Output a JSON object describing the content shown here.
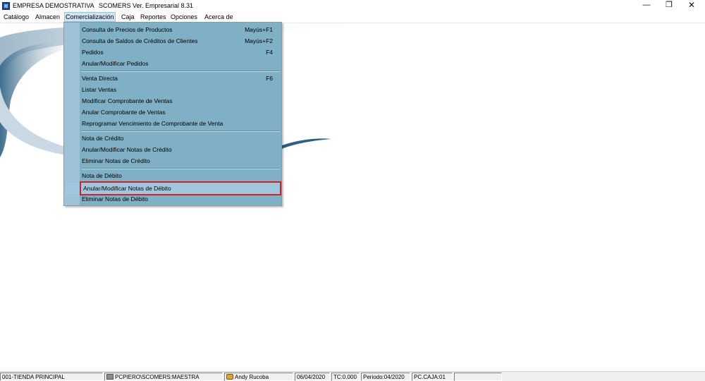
{
  "window": {
    "company": "EMPRESA DEMOSTRATIVA",
    "product": "SCOMERS Ver. Empresarial  8.31",
    "minimize_glyph": "—",
    "maximize_glyph": "❐",
    "close_glyph": "✕"
  },
  "menubar": {
    "items": [
      {
        "label": "Catálogo"
      },
      {
        "label": "Almacen"
      },
      {
        "label": "Comercialización"
      },
      {
        "label": "Caja"
      },
      {
        "label": "Reportes"
      },
      {
        "label": "Opciones"
      },
      {
        "label": "Acerca de"
      }
    ],
    "active": "Comercialización"
  },
  "dropdown": {
    "items": [
      {
        "label": "Consulta de Precios de Productos",
        "shortcut": "Mayús+F1"
      },
      {
        "label": "Consulta de Saldos de Créditos de Clientes",
        "shortcut": "Mayús+F2"
      },
      {
        "label": "Pedidos",
        "shortcut": "F4"
      },
      {
        "label": "Anular/Modificar Pedidos",
        "shortcut": ""
      },
      {
        "label": "Venta Directa",
        "shortcut": "F6"
      },
      {
        "label": "Listar Ventas",
        "shortcut": ""
      },
      {
        "label": "Modificar Comprobante de Ventas",
        "shortcut": ""
      },
      {
        "label": "Anular Comprobante de Ventas",
        "shortcut": ""
      },
      {
        "label": "Reprogramar Vencimiento de Comprobante de Venta",
        "shortcut": ""
      },
      {
        "label": "Nota de Crédito",
        "shortcut": ""
      },
      {
        "label": "Anular/Modificar Notas de Crédito",
        "shortcut": ""
      },
      {
        "label": "Eliminar Notas de Crédito",
        "shortcut": ""
      },
      {
        "label": "Nota de Débito",
        "shortcut": ""
      },
      {
        "label": "Anular/Modificar Notas de Débito",
        "shortcut": ""
      },
      {
        "label": "Eliminar Notas de Débito",
        "shortcut": ""
      }
    ],
    "highlighted": "Anular/Modificar Notas de Débito"
  },
  "statusbar": {
    "store": "001-TIENDA PRINCIPAL",
    "database": "PCPIERO\\SCOMERS:MAESTRA",
    "user": "Andy Rucoba",
    "date": "06/04/2020",
    "exchange_rate": "TC:0.000",
    "period": "Periodo:04/2020",
    "cashbox": "PC.CAJA:01"
  },
  "colors": {
    "menu_background": "#7fb0c6",
    "highlight_border": "#d42020",
    "highlight_fill": "#9fc8e0"
  }
}
